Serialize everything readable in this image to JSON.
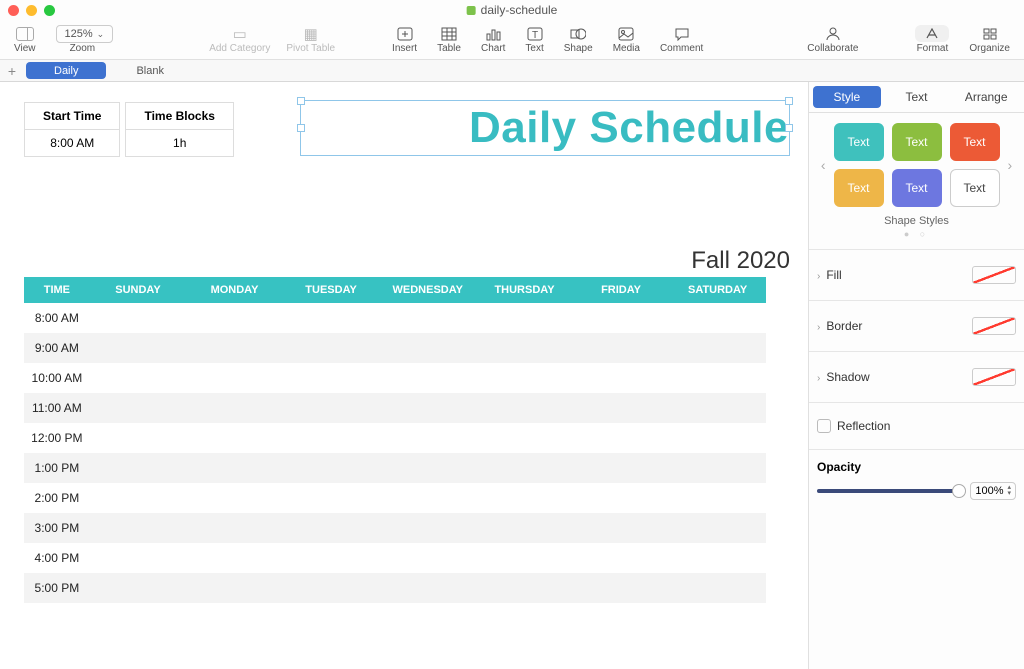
{
  "document": {
    "title": "daily-schedule"
  },
  "toolbar": {
    "view": "View",
    "zoom_label": "Zoom",
    "zoom_value": "125%",
    "add_category": "Add Category",
    "pivot_table": "Pivot Table",
    "insert": "Insert",
    "table": "Table",
    "chart": "Chart",
    "text": "Text",
    "shape": "Shape",
    "media": "Media",
    "comment": "Comment",
    "collaborate": "Collaborate",
    "format": "Format",
    "organize": "Organize"
  },
  "sheet_tabs": {
    "add": "+",
    "items": [
      "Daily",
      "Blank"
    ],
    "active": 0
  },
  "canvas": {
    "params": {
      "headers": [
        "Start Time",
        "Time Blocks"
      ],
      "values": [
        "8:00 AM",
        "1h"
      ]
    },
    "title": "Daily Schedule",
    "subtitle": "Fall 2020",
    "schedule": {
      "columns": [
        "TIME",
        "SUNDAY",
        "MONDAY",
        "TUESDAY",
        "WEDNESDAY",
        "THURSDAY",
        "FRIDAY",
        "SATURDAY"
      ],
      "times": [
        "8:00 AM",
        "9:00 AM",
        "10:00 AM",
        "11:00 AM",
        "12:00 PM",
        "1:00 PM",
        "2:00 PM",
        "3:00 PM",
        "4:00 PM",
        "5:00 PM"
      ]
    }
  },
  "inspector": {
    "tabs": [
      "Style",
      "Text",
      "Arrange"
    ],
    "active_tab": 0,
    "style_card_label": "Text",
    "shape_styles_label": "Shape Styles",
    "rows": {
      "fill": "Fill",
      "border": "Border",
      "shadow": "Shadow",
      "reflection": "Reflection"
    },
    "opacity": {
      "label": "Opacity",
      "value": "100%"
    }
  }
}
